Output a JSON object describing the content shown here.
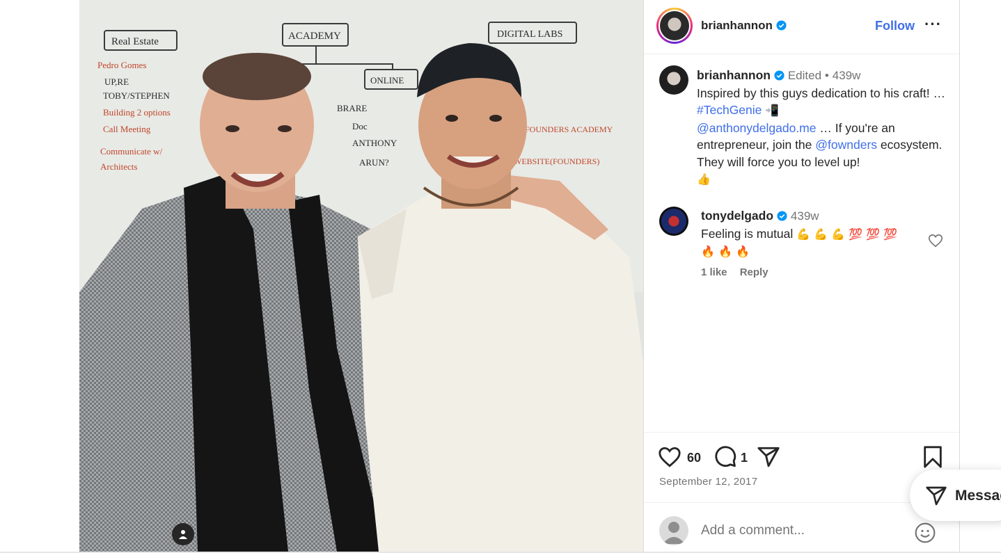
{
  "post": {
    "author": "brianhannon",
    "follow_label": "Follow",
    "more_label": "···"
  },
  "caption": {
    "username": "brianhannon",
    "edited": "Edited",
    "dot": "•",
    "age": "439w",
    "text_1": "Inspired by this guys dedication to his craft! … ",
    "hashtag": "#TechGenie",
    "emoji_1": "📲",
    "mention_1": "@anthonydelgado.me",
    "text_2": " … If you're an entrepreneur, join the ",
    "mention_2": "@fownders",
    "text_3": " ecosystem. They will force you to level up!",
    "emoji_2": "👍"
  },
  "comment": {
    "username": "tonydelgado",
    "age": "439w",
    "text": "Feeling is mutual",
    "emojis_1": "💪 💪 💪 💯 💯 💯",
    "emojis_2": "🔥 🔥 🔥",
    "likes": "1 like",
    "reply": "Reply"
  },
  "stats": {
    "likes": "60",
    "comments": "1",
    "date": "September 12, 2017"
  },
  "add_comment": {
    "placeholder": "Add a comment..."
  },
  "messages": {
    "label": "Messag"
  },
  "photo": {
    "board_labels": [
      "Real Estate",
      "ACADEMY",
      "DIGITAL LABS",
      "ONLINE"
    ],
    "board_left": [
      "Pedro Gomes",
      "UP,RE",
      "TOBY/STEPHEN",
      "Building 2 options",
      "Call Meeting",
      "Communicate w/",
      "Architects"
    ],
    "board_mid": [
      "BRARE",
      "Doc",
      "ANTHONY",
      "ARUN?"
    ],
    "board_right": [
      "FOUNDERS ACADEMY",
      "WEBSITE(FOUNDERS)"
    ]
  },
  "colors": {
    "accent": "#3f6ee8",
    "verified": "#0095f6",
    "muted": "#737373"
  }
}
